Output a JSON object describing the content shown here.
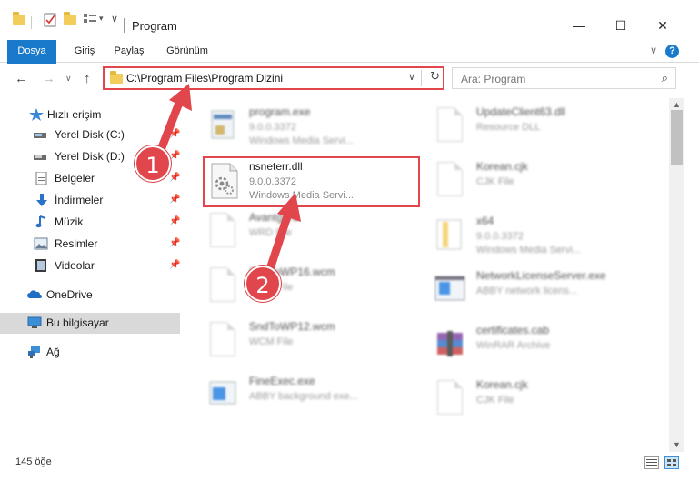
{
  "window": {
    "title": "Program",
    "controls": {
      "minimize": "—",
      "maximize": "☐",
      "close": "✕"
    }
  },
  "ribbon": {
    "tabs": [
      "Dosya",
      "Giriş",
      "Paylaş",
      "Görünüm"
    ],
    "help": "?",
    "collapse": "∨"
  },
  "nav": {
    "back": "←",
    "forward": "→",
    "recent": "∨",
    "up": "↑",
    "address": "C:\\Program Files\\Program Dizini",
    "search_placeholder": "Ara: Program"
  },
  "sidebar": {
    "items": [
      {
        "label": "Hızlı erişim",
        "icon": "star-icon"
      },
      {
        "label": "Yerel Disk (C:)",
        "icon": "drive-icon",
        "pinned": true
      },
      {
        "label": "Yerel Disk (D:)",
        "icon": "drive-icon",
        "pinned": true
      },
      {
        "label": "Belgeler",
        "icon": "documents-icon",
        "pinned": true
      },
      {
        "label": "İndirmeler",
        "icon": "download-icon",
        "pinned": true
      },
      {
        "label": "Müzik",
        "icon": "music-icon",
        "pinned": true
      },
      {
        "label": "Resimler",
        "icon": "pictures-icon",
        "pinned": true
      },
      {
        "label": "Videolar",
        "icon": "videos-icon",
        "pinned": true
      },
      {
        "label": "OneDrive",
        "icon": "cloud-icon"
      },
      {
        "label": "Bu bilgisayar",
        "icon": "computer-icon",
        "selected": true
      },
      {
        "label": "Ağ",
        "icon": "network-icon"
      }
    ]
  },
  "files": {
    "left": [
      {
        "name": "program.exe",
        "line1": "9.0.0.3372",
        "line2": "Windows Media Servi..."
      },
      {
        "name": "nsneterr.dll",
        "line1": "9.0.0.3372",
        "line2": "Windows Media Servi..."
      },
      {
        "name": "Avantgard",
        "line1": "WRD File",
        "line2": ""
      },
      {
        "name": "SndToWP16.wcm",
        "line1": "WCM File",
        "line2": ""
      },
      {
        "name": "SndToWP12.wcm",
        "line1": "WCM File",
        "line2": ""
      },
      {
        "name": "FineExec.exe",
        "line1": "ABBY background exe...",
        "line2": ""
      }
    ],
    "right": [
      {
        "name": "UpdateClient63.dll",
        "line1": "Resource DLL",
        "line2": ""
      },
      {
        "name": "Korean.cjk",
        "line1": "CJK File",
        "line2": ""
      },
      {
        "name": "x64",
        "line1": "9.0.0.3372",
        "line2": "Windows Media Servi..."
      },
      {
        "name": "NetworkLicenseServer.exe",
        "line1": "ABBY network licens...",
        "line2": ""
      },
      {
        "name": "certificates.cab",
        "line1": "WinRAR Archive",
        "line2": ""
      },
      {
        "name": "Korean.cjk",
        "line1": "CJK File",
        "line2": ""
      }
    ]
  },
  "status": {
    "count": "145 öğe"
  },
  "callouts": [
    "1",
    "2"
  ],
  "colors": {
    "accent": "#1979ca",
    "highlight": "#e0464c"
  }
}
